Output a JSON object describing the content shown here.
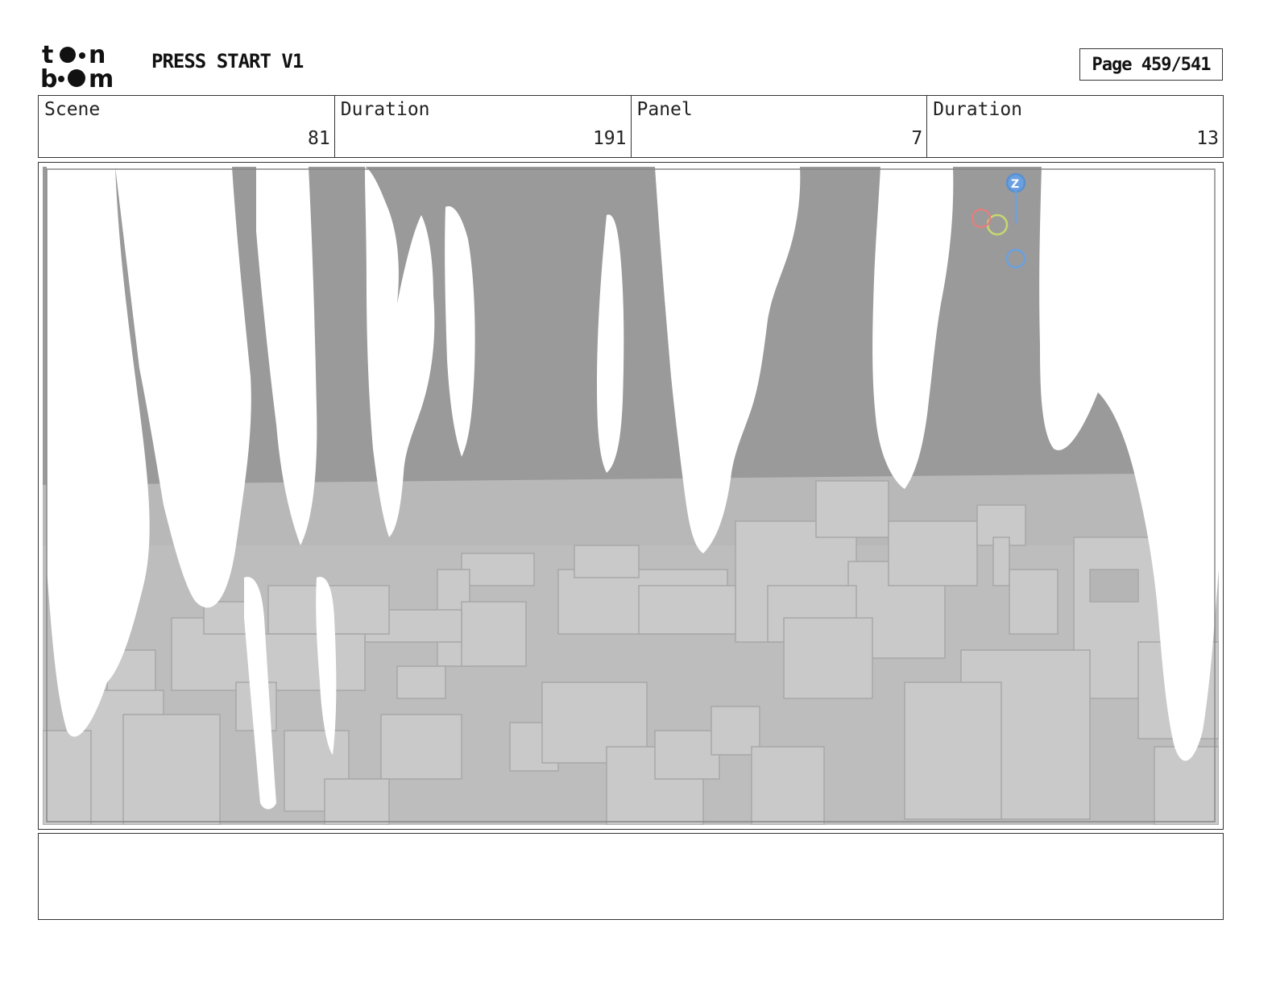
{
  "header": {
    "logo_text": "toon boom",
    "project_title": "PRESS START V1",
    "page_number": "Page 459/541"
  },
  "info": [
    {
      "label": "Scene",
      "value": "81"
    },
    {
      "label": "Duration",
      "value": "191"
    },
    {
      "label": "Panel",
      "value": "7"
    },
    {
      "label": "Duration",
      "value": "13"
    }
  ],
  "panel": {
    "gizmo_axis_label": "Z"
  },
  "notes": {
    "text": ""
  },
  "colors": {
    "sky": "#9a9a9a",
    "ground": "#b5b5b5",
    "blocks": "#c9c9c9",
    "drips": "#ffffff",
    "gizmo_z": "#6aa0e0",
    "gizmo_y": "#c8d870",
    "gizmo_x": "#e08080"
  }
}
